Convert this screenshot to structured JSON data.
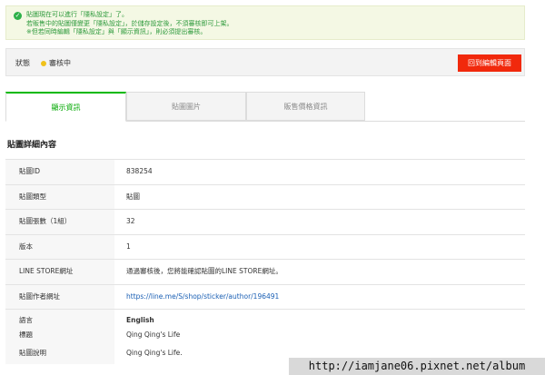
{
  "notice": {
    "icon": "check-circle-icon",
    "color": "#2e9a3c",
    "lines": [
      "貼圖現在可以進行「隱私設定」了。",
      "若販售中的貼圖僅變更「隱私設定」，於儲存設定後，不須審核即可上架。",
      "※但若同時編輯「隱私設定」與「顯示資訊」，則必須提出審核。"
    ]
  },
  "status": {
    "label": "狀態",
    "value": "審核中",
    "dot_color": "#f0c11a",
    "button": "回到編輯頁面",
    "button_color": "#f1290c"
  },
  "tabs": [
    {
      "label": "顯示資訊",
      "active": true
    },
    {
      "label": "貼圖圖片",
      "active": false
    },
    {
      "label": "販售價格資訊",
      "active": false
    }
  ],
  "section_title": "貼圖詳細內容",
  "details": [
    {
      "key": "貼圖ID",
      "value": "838254"
    },
    {
      "key": "貼圖類型",
      "value": "貼圖"
    },
    {
      "key": "貼圖張數（1組）",
      "value": "32"
    },
    {
      "key": "版本",
      "value": "1"
    },
    {
      "key": "LINE STORE網址",
      "value": "通過審核後，您將能確認貼圖的LINE STORE網址。"
    },
    {
      "key": "貼圖作者網址",
      "value": "https://line.me/S/shop/sticker/author/196491"
    },
    {
      "key": "語言",
      "value": "English"
    },
    {
      "key": "標題",
      "value": "Qing Qing's Life"
    },
    {
      "key": "貼圖說明",
      "value": "Qing Qing's Life."
    }
  ],
  "watermark": "http://iamjane06.pixnet.net/album"
}
